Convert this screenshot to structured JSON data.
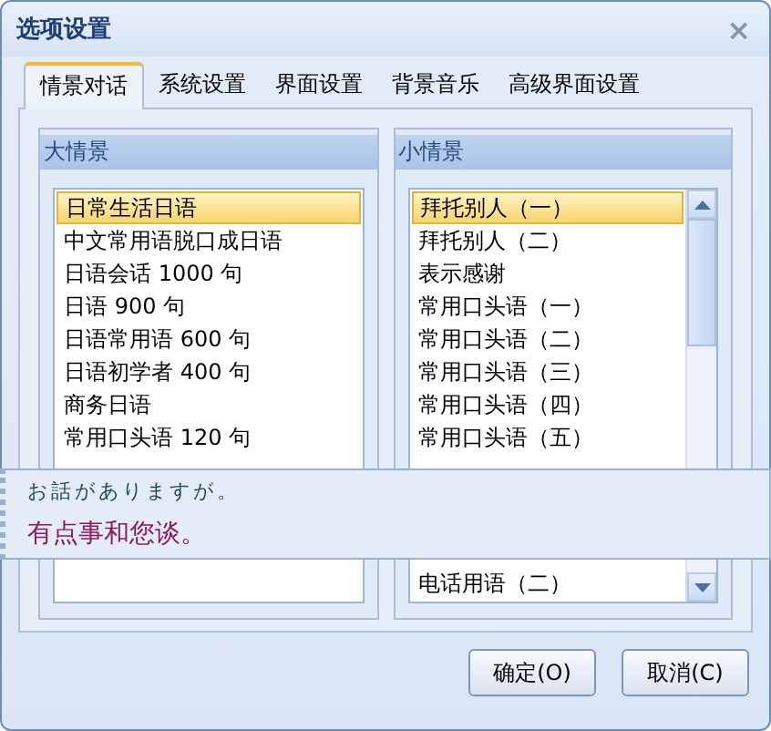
{
  "window": {
    "title": "选项设置",
    "close": "×"
  },
  "tabs": [
    {
      "label": "情景对话",
      "selected": true
    },
    {
      "label": "系统设置",
      "selected": false
    },
    {
      "label": "界面设置",
      "selected": false
    },
    {
      "label": "背景音乐",
      "selected": false
    },
    {
      "label": "高级界面设置",
      "selected": false
    }
  ],
  "groups": [
    {
      "title": "大情景",
      "scrollbar": false,
      "items": [
        {
          "label": "日常生活日语",
          "selected": true
        },
        {
          "label": "中文常用语脱口成日语",
          "selected": false
        },
        {
          "label": "日语会话 1000 句",
          "selected": false
        },
        {
          "label": "日语 900 句",
          "selected": false
        },
        {
          "label": "日语常用语 600 句",
          "selected": false
        },
        {
          "label": "日语初学者 400 句",
          "selected": false
        },
        {
          "label": "商务日语",
          "selected": false
        },
        {
          "label": "常用口头语 120 句",
          "selected": false
        }
      ]
    },
    {
      "title": "小情景",
      "scrollbar": true,
      "items": [
        {
          "label": "拜托别人（一）",
          "selected": true
        },
        {
          "label": "拜托别人（二）",
          "selected": false
        },
        {
          "label": "表示感谢",
          "selected": false
        },
        {
          "label": "常用口头语（一）",
          "selected": false
        },
        {
          "label": "常用口头语（二）",
          "selected": false
        },
        {
          "label": "常用口头语（三）",
          "selected": false
        },
        {
          "label": "常用口头语（四）",
          "selected": false
        },
        {
          "label": "常用口头语（五）",
          "selected": false
        }
      ],
      "items_after_overlay": [
        {
          "label": "电话用语（二）",
          "selected": false
        }
      ]
    }
  ],
  "popup": {
    "japanese": "お話がありますが。",
    "chinese": "有点事和您谈。"
  },
  "buttons": [
    {
      "label": "确定(O)"
    },
    {
      "label": "取消(C)"
    }
  ]
}
